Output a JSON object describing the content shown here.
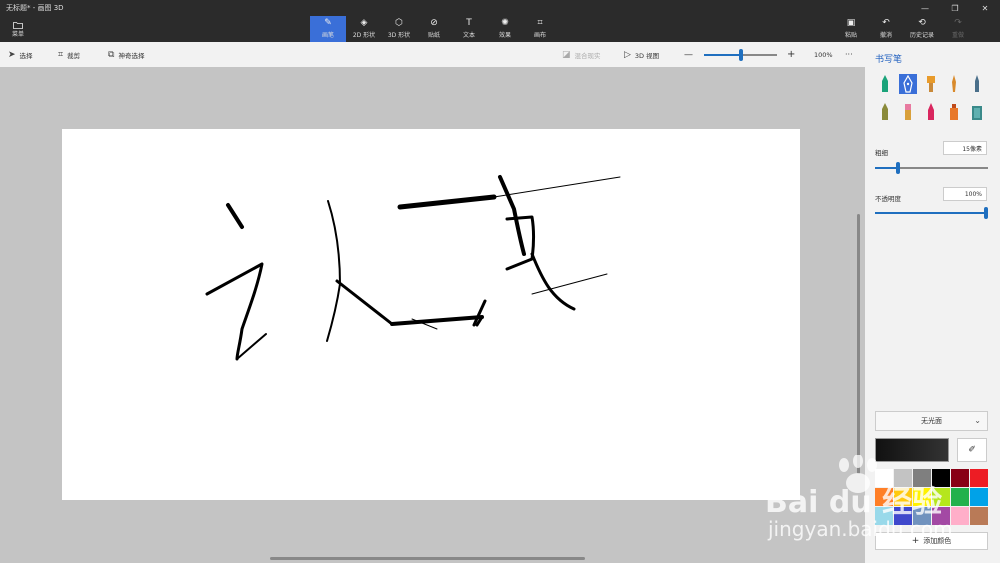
{
  "window": {
    "title": "无标题* - 画图 3D",
    "minimize": "—",
    "restore": "❐",
    "close": "✕"
  },
  "ribbon": {
    "menu_label": "菜单",
    "tools": [
      {
        "label": "画笔",
        "icon": "brush-icon",
        "glyph": "✎"
      },
      {
        "label": "2D 形状",
        "icon": "shapes-2d-icon",
        "glyph": "◈"
      },
      {
        "label": "3D 形状",
        "icon": "cube-icon",
        "glyph": "⬡"
      },
      {
        "label": "贴纸",
        "icon": "sticker-icon",
        "glyph": "⊘"
      },
      {
        "label": "文本",
        "icon": "text-icon",
        "glyph": "T"
      },
      {
        "label": "效果",
        "icon": "effects-icon",
        "glyph": "✺"
      },
      {
        "label": "画布",
        "icon": "canvas-icon",
        "glyph": "⌗"
      }
    ],
    "right_tools": [
      {
        "label": "粘贴",
        "icon": "paste-icon",
        "glyph": "▣"
      },
      {
        "label": "撤消",
        "icon": "undo-icon",
        "glyph": "↶"
      },
      {
        "label": "历史记录",
        "icon": "history-icon",
        "glyph": "⟲"
      },
      {
        "label": "重做",
        "icon": "redo-icon",
        "glyph": "↷"
      }
    ]
  },
  "toolbar": {
    "select": "选择",
    "crop": "裁剪",
    "magic_select": "神奇选择",
    "mixed_reality": "混合现实",
    "view_3d": "3D 视图",
    "zoom_minus": "—",
    "zoom_plus": "+",
    "zoom_level": "100%",
    "zoom_fraction": 0.5,
    "more": "···"
  },
  "panel": {
    "title": "书写笔",
    "thickness_label": "粗细",
    "thickness_value": "15像素",
    "thickness_fraction": 0.2,
    "opacity_label": "不透明度",
    "opacity_value": "100%",
    "opacity_fraction": 1.0,
    "finish": "无光面",
    "add_color": "添加颜色"
  },
  "colors": {
    "accent": "#3a6fd8",
    "swatches": [
      "#ffffff",
      "#c3c3c3",
      "#7f7f7f",
      "#000000",
      "#880015",
      "#ed1c24",
      "#ff7f27",
      "#ffc90e",
      "#fff200",
      "#b5e61d",
      "#22b14c",
      "#00a2e8",
      "#99d9ea",
      "#3f48cc",
      "#7092be",
      "#a349a4",
      "#ffaec9",
      "#b97a57"
    ]
  },
  "watermark": {
    "brand": "Bai du 经验",
    "url": "jingyan.baidu.com"
  }
}
